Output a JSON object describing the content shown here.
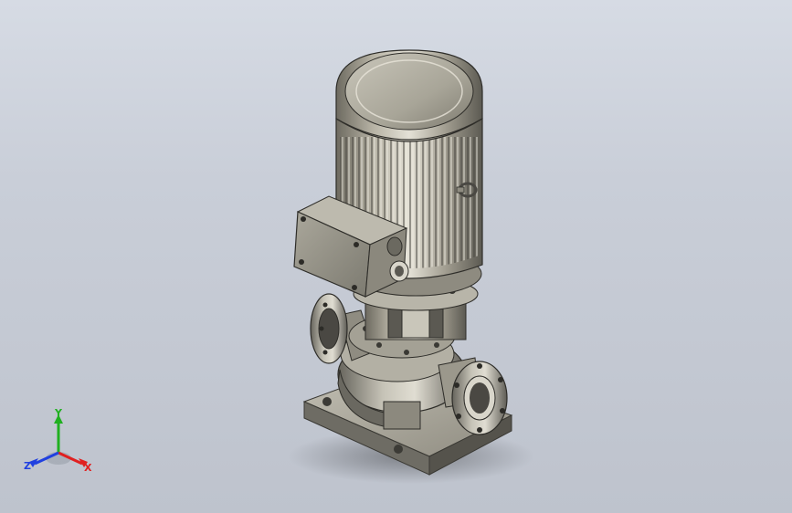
{
  "viewport": {
    "background_top": "#d6dbe4",
    "background_bottom": "#bec3cd",
    "model": "vertical-inline-pump-assembly"
  },
  "triad": {
    "x_label": "X",
    "y_label": "Y",
    "z_label": "Z",
    "x_color": "#e02020",
    "y_color": "#20b020",
    "z_color": "#2040e0"
  }
}
